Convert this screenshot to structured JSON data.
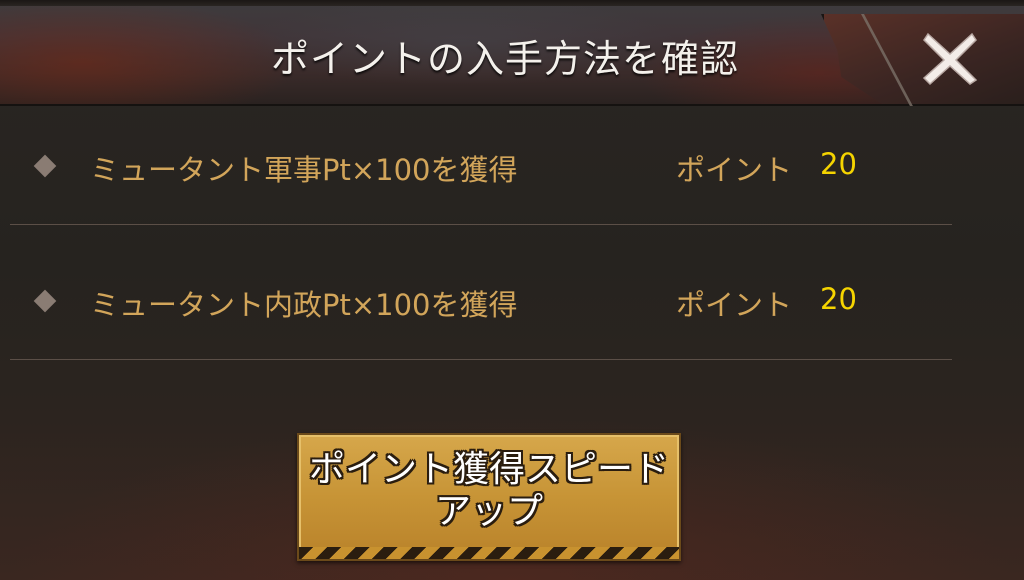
{
  "dialog": {
    "title": "ポイントの入手方法を確認",
    "close_icon": "close-icon"
  },
  "rows": [
    {
      "label": "ミュータント軍事Pt×100を獲得",
      "points_label": "ポイント",
      "points_value": "20"
    },
    {
      "label": "ミュータント内政Pt×100を獲得",
      "points_label": "ポイント",
      "points_value": "20"
    }
  ],
  "action": {
    "speed_up_label": "ポイント獲得スピードアップ"
  },
  "colors": {
    "label_gold": "#d2a55a",
    "value_yellow": "#f5d400",
    "button_gold": "#c79436"
  }
}
